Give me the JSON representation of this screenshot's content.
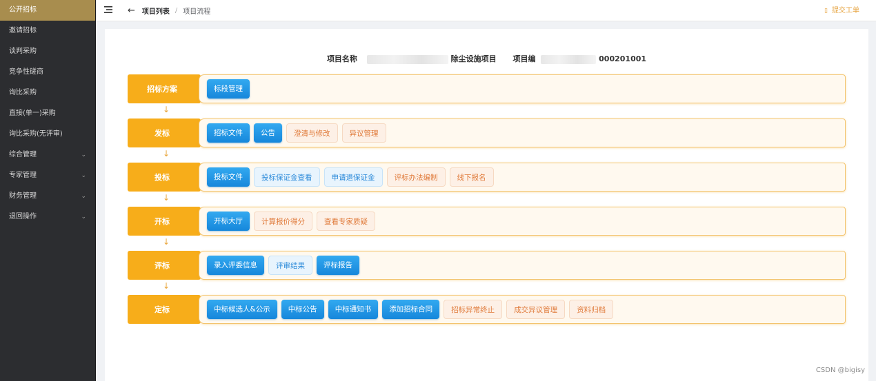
{
  "sidebar": {
    "items": [
      {
        "label": "公开招标",
        "active": true,
        "chevron": false
      },
      {
        "label": "邀请招标",
        "active": false,
        "chevron": false
      },
      {
        "label": "谈判采购",
        "active": false,
        "chevron": false
      },
      {
        "label": "竞争性磋商",
        "active": false,
        "chevron": false
      },
      {
        "label": "询比采购",
        "active": false,
        "chevron": false
      },
      {
        "label": "直接(单一)采购",
        "active": false,
        "chevron": false
      },
      {
        "label": "询比采购(无评审)",
        "active": false,
        "chevron": false
      },
      {
        "label": "综合管理",
        "active": false,
        "chevron": true
      },
      {
        "label": "专家管理",
        "active": false,
        "chevron": true
      },
      {
        "label": "财务管理",
        "active": false,
        "chevron": true
      },
      {
        "label": "退回操作",
        "active": false,
        "chevron": true
      }
    ]
  },
  "topbar": {
    "menu_icon": "hamburger-icon",
    "back_icon": "arrow-left-icon",
    "breadcrumb": {
      "level1": "项目列表",
      "separator": "/",
      "level2": "项目流程"
    },
    "submit_label": "提交工单",
    "submit_icon": "clipboard-icon"
  },
  "project": {
    "name_label": "项目名称",
    "name_value_visible": "除尘设施项目",
    "code_label": "项目编",
    "code_value_visible": "000201001"
  },
  "stages": [
    {
      "label": "招标方案",
      "buttons": [
        {
          "label": "标段管理",
          "style": "primary"
        }
      ]
    },
    {
      "label": "发标",
      "buttons": [
        {
          "label": "招标文件",
          "style": "primary"
        },
        {
          "label": "公告",
          "style": "primary"
        },
        {
          "label": "澄清与修改",
          "style": "warn"
        },
        {
          "label": "异议管理",
          "style": "warn"
        }
      ]
    },
    {
      "label": "投标",
      "buttons": [
        {
          "label": "投标文件",
          "style": "primary"
        },
        {
          "label": "投标保证金查看",
          "style": "light"
        },
        {
          "label": "申请退保证金",
          "style": "light"
        },
        {
          "label": "评标办法编制",
          "style": "warn"
        },
        {
          "label": "线下报名",
          "style": "warn"
        }
      ]
    },
    {
      "label": "开标",
      "buttons": [
        {
          "label": "开标大厅",
          "style": "primary"
        },
        {
          "label": "计算报价得分",
          "style": "warn"
        },
        {
          "label": "查看专家质疑",
          "style": "warn"
        }
      ]
    },
    {
      "label": "评标",
      "buttons": [
        {
          "label": "录入评委信息",
          "style": "primary"
        },
        {
          "label": "评审结果",
          "style": "light"
        },
        {
          "label": "评标报告",
          "style": "primary"
        }
      ]
    },
    {
      "label": "定标",
      "buttons": [
        {
          "label": "中标候选人&公示",
          "style": "primary"
        },
        {
          "label": "中标公告",
          "style": "primary"
        },
        {
          "label": "中标通知书",
          "style": "primary"
        },
        {
          "label": "添加招标合同",
          "style": "primary"
        },
        {
          "label": "招标异常终止",
          "style": "warn"
        },
        {
          "label": "成交异议管理",
          "style": "warn"
        },
        {
          "label": "资料归档",
          "style": "warn"
        }
      ]
    }
  ],
  "flow_arrow": "↓",
  "watermark": "CSDN @bigisy",
  "colors": {
    "sidebar_bg": "#2c2d30",
    "sidebar_active": "#a88d4e",
    "stage_orange": "#f7ad1a",
    "primary_blue": "#1687db",
    "warn_text": "#e07a3a"
  }
}
